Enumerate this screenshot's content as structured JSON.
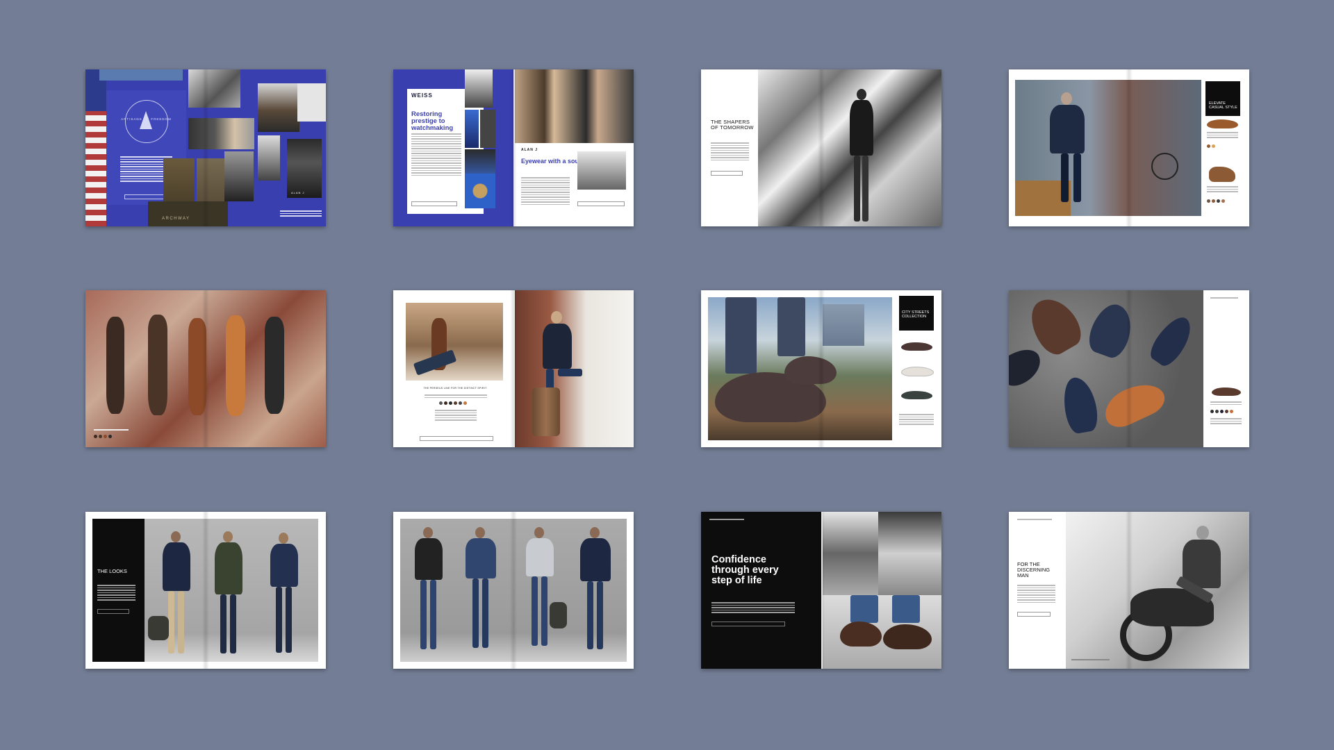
{
  "page": {
    "background": "#737d95"
  },
  "colors": {
    "brand_blue": "#3a3fb0",
    "black": "#0d0d0d",
    "white": "#ffffff"
  },
  "spreads": {
    "s1": {
      "badge": "ARTISANS OF FREEDOM",
      "brand": "ARCHWAY",
      "model": "ALAN J"
    },
    "s2": {
      "brand": "WEISS",
      "headline": "Restoring prestige to watchmaking",
      "brand2": "ALAN J",
      "headline2": "Eyewear with a soul"
    },
    "s3": {
      "headline": "THE SHAPERS OF TOMORROW"
    },
    "s4": {
      "headline": "ELEVATE CASUAL STYLE"
    },
    "s5": {},
    "s6": {
      "caption": "THE PERSEUS LINE FOR THE DISTINCT SPIRIT"
    },
    "s7": {
      "headline": "CITY STREETS COLLECTION"
    },
    "s8": {},
    "s9": {
      "headline": "THE LOOKS"
    },
    "s10": {},
    "s11": {
      "headline": "Confidence through every step of life"
    },
    "s12": {
      "headline": "FOR THE DISCERNING MAN"
    }
  }
}
